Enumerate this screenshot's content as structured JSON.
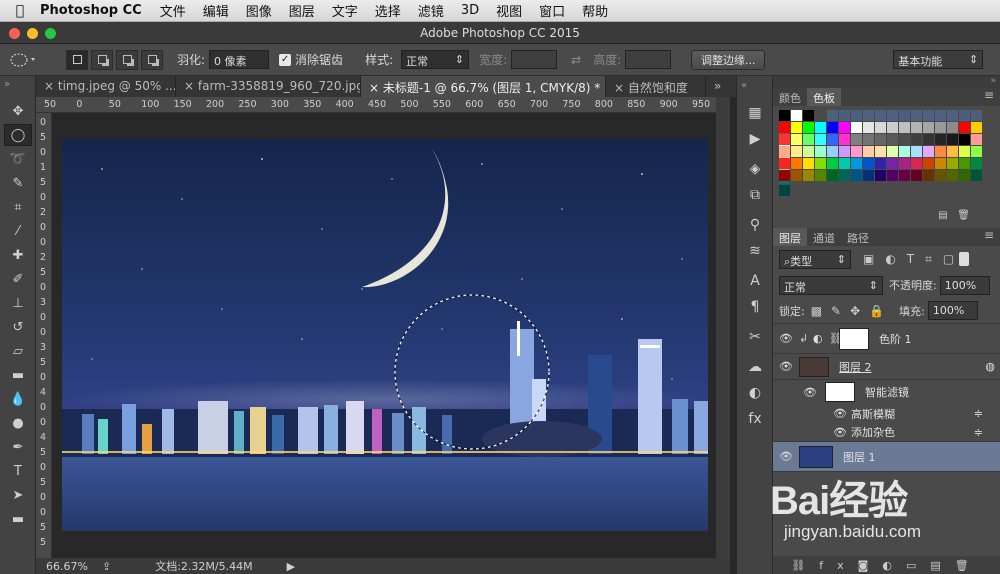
{
  "menubar": {
    "app": "Photoshop CC",
    "items": [
      "文件",
      "编辑",
      "图像",
      "图层",
      "文字",
      "选择",
      "滤镜",
      "3D",
      "视图",
      "窗口",
      "帮助"
    ]
  },
  "window": {
    "title": "Adobe Photoshop CC 2015"
  },
  "options": {
    "feather_label": "羽化:",
    "feather_value": "0 像素",
    "antialias_label": "消除锯齿",
    "style_label": "样式:",
    "style_value": "正常",
    "width_label": "宽度:",
    "height_label": "高度:",
    "refine_edge": "调整边缘...",
    "workspace": "基本功能"
  },
  "tabs": [
    "timg.jpeg @ 50% ...",
    "farm-3358819_960_720.jpg",
    "未标题-1 @ 66.7% (图层 1, CMYK/8) *",
    "自然饱和度"
  ],
  "ruler_top": [
    "50",
    "0",
    "50",
    "100",
    "150",
    "200",
    "250",
    "300",
    "350",
    "400",
    "450",
    "500",
    "550",
    "600",
    "650",
    "700",
    "750",
    "800",
    "850",
    "900",
    "950"
  ],
  "ruler_left": [
    "0",
    "5",
    "0",
    "1",
    "5",
    "0",
    "2",
    "0",
    "0",
    "2",
    "5",
    "0",
    "3",
    "0",
    "0",
    "3",
    "5",
    "0",
    "4",
    "0",
    "0",
    "4",
    "5",
    "0",
    "5",
    "0",
    "0",
    "5",
    "5"
  ],
  "status": {
    "zoom": "66.67%",
    "doc": "文档:2.32M/5.44M"
  },
  "color_panel": {
    "tabs": [
      "颜色",
      "色板"
    ],
    "active": "色板",
    "swatch_rows": [
      [
        "#000000",
        "#ffffff",
        "#000000",
        "#4a4a4a",
        "#4f5f7a",
        "#4a5f80",
        "#4a6080",
        "#506080",
        "#4f6080",
        "#4f6085",
        "#4a5f80",
        "#4f6080",
        "#506080",
        "#4f6085",
        "#506080",
        "#4a5f80",
        "#4f5f7a",
        "#4f5f80"
      ],
      [
        "#ff0000",
        "#ffff00",
        "#00ff00",
        "#00ffff",
        "#0000ff",
        "#ff00ff",
        "#ffffff",
        "#e6e6e6",
        "#d9d9d9",
        "#cccccc",
        "#bfbfbf",
        "#b3b3b3",
        "#a6a6a6",
        "#999999",
        "#8c8c8c",
        "#ff0000",
        "#ffcc00",
        "#ffffff"
      ],
      [
        "#ff3333",
        "#ffff66",
        "#66ff66",
        "#33ffff",
        "#3366ff",
        "#ff33cc",
        "#808080",
        "#737373",
        "#666666",
        "#595959",
        "#4d4d4d",
        "#404040",
        "#333333",
        "#262626",
        "#1a1a1a",
        "#000000",
        "#ff9999",
        "#ffcc99"
      ],
      [
        "#ffaa88",
        "#ffee88",
        "#ccff99",
        "#99ffcc",
        "#99ccff",
        "#cc99ff",
        "#ff99cc",
        "#ffccaa",
        "#ffe0aa",
        "#e0ffaa",
        "#aaffe0",
        "#aae0ff",
        "#e0aaff",
        "#ff8844",
        "#ffbb44",
        "#ddff44",
        "#88ff44",
        "#44ffaa"
      ],
      [
        "#ff2222",
        "#ff7700",
        "#ffdd00",
        "#88dd00",
        "#00cc44",
        "#00ccaa",
        "#0099dd",
        "#0055cc",
        "#3322aa",
        "#7722aa",
        "#aa2288",
        "#dd2255",
        "#cc4400",
        "#cc8800",
        "#99aa00",
        "#449900",
        "#008844",
        "#007777"
      ],
      [
        "#990000",
        "#995500",
        "#998800",
        "#558800",
        "#006622",
        "#006655",
        "#005588",
        "#003377",
        "#220066",
        "#550066",
        "#660044",
        "#660022",
        "#663300",
        "#665500",
        "#556600",
        "#336600",
        "#005533",
        "#004444"
      ]
    ]
  },
  "layers_panel": {
    "tabs": [
      "图层",
      "通道",
      "路径"
    ],
    "filter_kind": "类型",
    "blend_mode": "正常",
    "opacity_label": "不透明度:",
    "opacity_value": "100%",
    "lock_label": "锁定:",
    "fill_label": "填充:",
    "fill_value": "100%",
    "layers": [
      "色阶 1",
      "图层 2",
      "智能滤镜",
      "高斯模糊",
      "添加杂色",
      "图层 1"
    ]
  },
  "watermark": {
    "brand": "Bai经验",
    "url": "jingyan.baidu.com"
  }
}
